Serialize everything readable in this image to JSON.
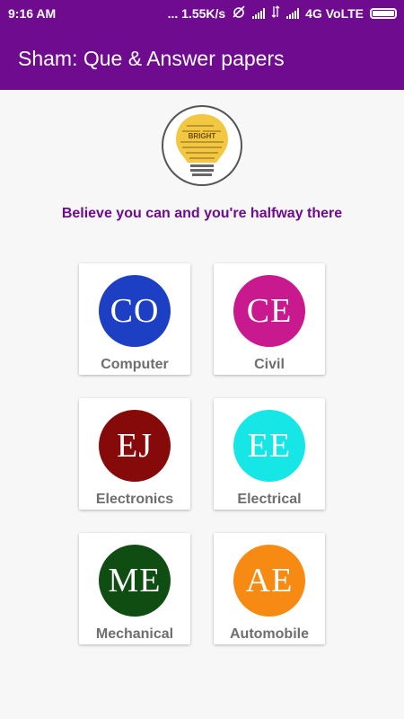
{
  "status_bar": {
    "time": "9:16 AM",
    "speed": "... 1.55K/s",
    "network": "4G VoLTE"
  },
  "app_bar": {
    "title": "Sham: Que & Answer papers"
  },
  "logo": {
    "icon": "lightbulb-icon",
    "text": "BRIGHT"
  },
  "quote": "Believe you can and you're halfway there",
  "branches": [
    {
      "abbr": "CO",
      "label": "Computer",
      "color": "#1d3fc4"
    },
    {
      "abbr": "CE",
      "label": "Civil",
      "color": "#c9198f"
    },
    {
      "abbr": "EJ",
      "label": "Electronics",
      "color": "#870a0a"
    },
    {
      "abbr": "EE",
      "label": "Electrical",
      "color": "#17e6e6"
    },
    {
      "abbr": "ME",
      "label": "Mechanical",
      "color": "#0f4d12"
    },
    {
      "abbr": "AE",
      "label": "Automobile",
      "color": "#f78a12"
    }
  ]
}
